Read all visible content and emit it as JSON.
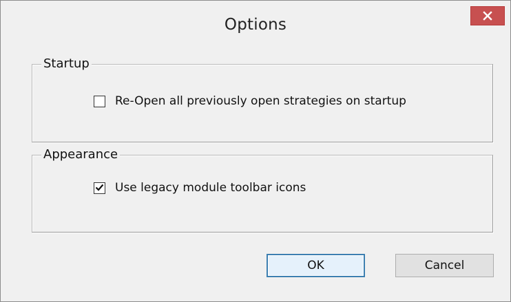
{
  "window": {
    "title": "Options"
  },
  "groups": {
    "startup": {
      "legend": "Startup",
      "checkbox_label": "Re-Open all previously open strategies on startup",
      "checked": false
    },
    "appearance": {
      "legend": "Appearance",
      "checkbox_label": "Use legacy module toolbar icons",
      "checked": true
    }
  },
  "buttons": {
    "ok_label": "OK",
    "cancel_label": "Cancel"
  },
  "icons": {
    "close": "close-icon",
    "check": "checkmark-icon"
  },
  "colors": {
    "close_button": "#c75050",
    "dialog_background": "#f0f0f0",
    "default_button_border": "#3c7fb1"
  }
}
